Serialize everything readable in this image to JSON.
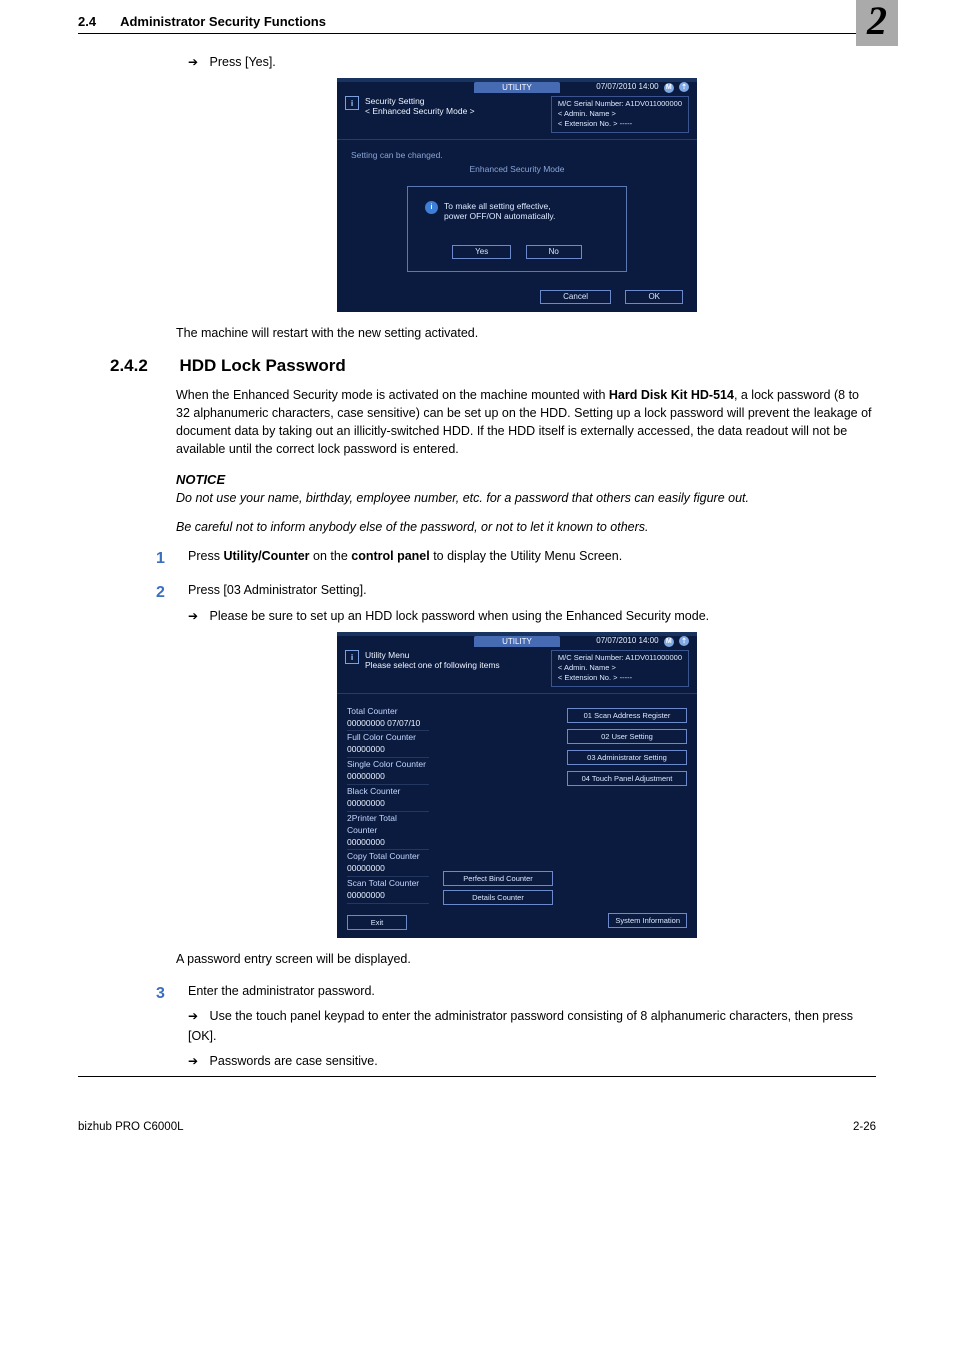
{
  "header": {
    "num": "2.4",
    "title": "Administrator Security Functions",
    "bigNumber": "2"
  },
  "text": {
    "pressYes": "Press [Yes].",
    "restartMsg": "The machine will restart with the new setting activated.",
    "sectionNum": "2.4.2",
    "sectionTitle": "HDD Lock Password",
    "intro1": "When the Enhanced Security mode is activated on the machine mounted with ",
    "intro1b": "Hard Disk Kit HD-514",
    "intro1c": ", a lock password (8 to 32 alphanumeric characters, case sensitive) can be set up on the HDD. Setting up a lock password will prevent the leakage of document data by taking out an illicitly-switched HDD. If the HDD itself is externally accessed, the data readout will not be available until the correct lock password is entered.",
    "notice": "NOTICE",
    "noticeLine1": "Do not use your name, birthday, employee number, etc. for a password that others can easily figure out.",
    "noticeLine2": "Be careful not to inform anybody else of the password, or not to let it known to others.",
    "step1a": "Press ",
    "step1b": "Utility/Counter",
    "step1c": " on the ",
    "step1d": "control panel",
    "step1e": " to display the Utility Menu Screen.",
    "step2": "Press [03 Administrator Setting].",
    "step2arrow": "Please be sure to set up an HDD lock password when using the Enhanced Security mode.",
    "afterScreen2": "A password entry screen will be displayed.",
    "step3": "Enter the administrator password.",
    "step3arrowA": "Use the touch panel keypad to enter the administrator password consisting of 8 alphanumeric characters, then press [OK].",
    "step3arrowB": "Passwords are case sensitive."
  },
  "screen1": {
    "utility": "UTILITY",
    "date": "07/07/2010 14:00",
    "i": "i",
    "title1": "Security Setting",
    "title2": "< Enhanced Security Mode >",
    "serial": "M/C Serial Number: A1DV011000000",
    "admin": "< Admin. Name >",
    "ext": "< Extension No. >  -----",
    "heading": "Setting can be changed.",
    "sub": "Enhanced Security Mode",
    "modalMsg1": "To make all setting effective,",
    "modalMsg2": "power OFF/ON automatically.",
    "yes": "Yes",
    "no": "No",
    "cancel": "Cancel",
    "ok": "OK"
  },
  "screen2": {
    "utility": "UTILITY",
    "date": "07/07/2010 14:00",
    "title1": "Utility Menu",
    "title2": "Please select one of following items",
    "serial": "M/C Serial Number: A1DV011000000",
    "admin": "< Admin. Name >",
    "ext": "< Extension No. >  -----",
    "counters": [
      {
        "lbl": "Total Counter",
        "val": "00000000  07/07/10"
      },
      {
        "lbl": "Full Color Counter",
        "val": "00000000"
      },
      {
        "lbl": "Single Color Counter",
        "val": "00000000"
      },
      {
        "lbl": "Black Counter",
        "val": "00000000"
      },
      {
        "lbl": "2Printer Total Counter",
        "val": "00000000"
      },
      {
        "lbl": "Copy Total Counter",
        "val": "00000000"
      },
      {
        "lbl": "Scan Total Counter",
        "val": "00000000"
      }
    ],
    "perfectBind": "Perfect Bind Counter",
    "details": "Details Counter",
    "sysinfo": "System Information",
    "right": [
      "01 Scan Address Register",
      "02 User Setting",
      "03 Administrator Setting",
      "04 Touch Panel Adjustment"
    ],
    "exit": "Exit"
  },
  "footer": {
    "model": "bizhub PRO C6000L",
    "page": "2-26"
  }
}
